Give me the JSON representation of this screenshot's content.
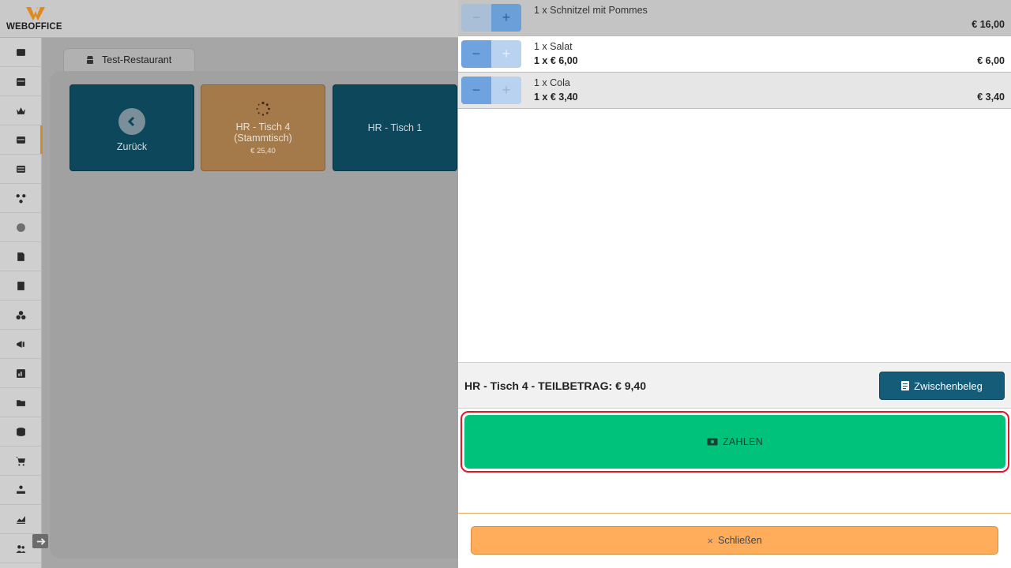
{
  "app": {
    "logo_text": "WEBOFFICE"
  },
  "tab": {
    "label": "Test-Restaurant"
  },
  "tiles": {
    "back": {
      "label": "Zurück"
    },
    "table4": {
      "line1": "HR - Tisch 4",
      "line2": "(Stammtisch)",
      "amount": "€ 25,40"
    },
    "table1": {
      "label": "HR - Tisch 1"
    }
  },
  "order_items": [
    {
      "name": "1 x Schnitzel mit Pommes",
      "qty_price": "",
      "total": "€ 16,00"
    },
    {
      "name": "1 x Salat",
      "qty_price": "1 x € 6,00",
      "total": "€ 6,00"
    },
    {
      "name": "1 x Cola",
      "qty_price": "1 x € 3,40",
      "total": "€ 3,40"
    }
  ],
  "stepper": {
    "minus": "−",
    "plus": "+"
  },
  "summary": {
    "text": "HR - Tisch 4 - TEILBETRAG: € 9,40",
    "zwischenbeleg_label": "Zwischenbeleg"
  },
  "pay": {
    "label": "ZAHLEN"
  },
  "close": {
    "icon": "×",
    "label": "Schließen"
  },
  "colors": {
    "accent_orange": "#ffad5b",
    "pay_green": "#00c27a",
    "primary_teal": "#145c78",
    "highlight_red": "#e0192a"
  }
}
